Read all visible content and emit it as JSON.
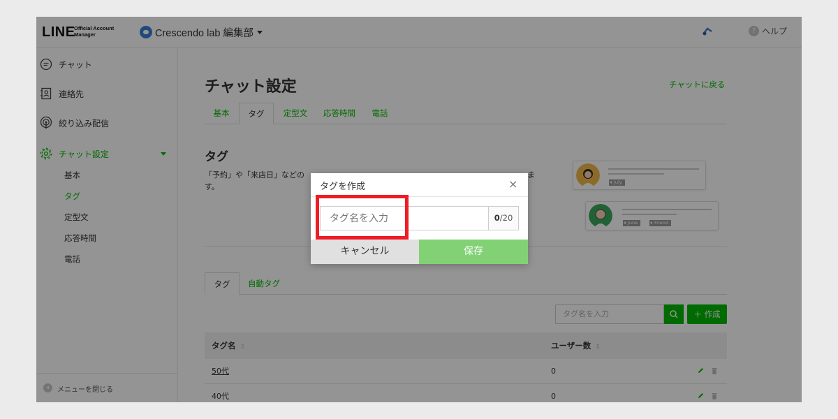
{
  "header": {
    "logo_text": "LINE",
    "logo_sub": "Official Account Manager",
    "account_name": "Crescendo lab 編集部",
    "help_label": "ヘルプ",
    "help_icon": "?"
  },
  "sidebar": {
    "items": [
      {
        "label": "チャット",
        "icon": "chat-bubble-icon"
      },
      {
        "label": "連絡先",
        "icon": "contacts-icon"
      },
      {
        "label": "絞り込み配信",
        "icon": "broadcast-icon"
      },
      {
        "label": "チャット設定",
        "icon": "gear-icon"
      }
    ],
    "sub_items": [
      "基本",
      "タグ",
      "定型文",
      "応答時間",
      "電話"
    ],
    "close_menu": "メニューを閉じる"
  },
  "main": {
    "title": "チャット設定",
    "back_link": "チャットに戻る",
    "tabs": [
      "基本",
      "タグ",
      "定型文",
      "応答時間",
      "電話"
    ],
    "section_title": "タグ",
    "section_desc_1": "「予約」や「来店日」などの",
    "section_desc_2": "ま",
    "section_desc_3": "す。",
    "illustration": {
      "tags": [
        "July",
        "June",
        "Friend"
      ]
    },
    "tabs2": [
      "タグ",
      "自動タグ"
    ],
    "search_placeholder": "タグ名を入力",
    "create_label": "＋ 作成",
    "table": {
      "headers": [
        "タグ名",
        "ユーザー数"
      ],
      "sort_glyph": "⇕",
      "rows": [
        {
          "name": "50代",
          "count": "0"
        },
        {
          "name": "40代",
          "count": "0"
        }
      ]
    }
  },
  "modal": {
    "title": "タグを作成",
    "close_glyph": "×",
    "input_placeholder": "タグ名を入力",
    "counter_current": "0",
    "counter_max": "/20",
    "cancel_label": "キャンセル",
    "save_label": "保存"
  },
  "colors": {
    "accent": "#00b900",
    "save_button": "#82d275",
    "highlight": "#ee1c25"
  }
}
